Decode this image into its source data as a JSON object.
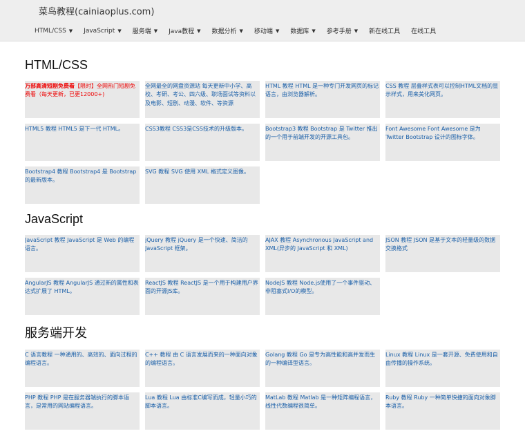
{
  "header": {
    "brand": "菜鸟教程(cainiaoplus.com)",
    "nav": [
      {
        "label": "HTML/CSS",
        "dropdown": true
      },
      {
        "label": "JavaScript",
        "dropdown": true
      },
      {
        "label": "服务端",
        "dropdown": true
      },
      {
        "label": "Java教程",
        "dropdown": true
      },
      {
        "label": "数据分析",
        "dropdown": true
      },
      {
        "label": "移动端",
        "dropdown": true
      },
      {
        "label": "数据库",
        "dropdown": true
      },
      {
        "label": "参考手册",
        "dropdown": true
      },
      {
        "label": "新在线工具",
        "dropdown": false
      },
      {
        "label": "在线工具",
        "dropdown": false
      }
    ]
  },
  "sections": [
    {
      "title": "HTML/CSS",
      "cards": [
        {
          "ad": true,
          "ad_bold": "万部高清短剧免费看",
          "ad_rest": "【限时】全网热门短剧免费看（每天更新，已更12000+)"
        },
        {
          "text": "全网最全的网盘资源站 每天更新中小学、高校、考研、考公、四六级、职场面试等资料以及电影、短剧、动漫、软件、等资源"
        },
        {
          "text": "HTML 教程 HTML 是一种专门开发网页的标记语言，由浏览器解析。"
        },
        {
          "text": "CSS 教程 层叠样式表可以控制HTML文档的显示样式，用来美化网页。"
        },
        {
          "text": "HTML5 教程 HTML5 是下一代 HTML。"
        },
        {
          "text": "CSS3教程 CSS3是CSS技术的升级版本。"
        },
        {
          "text": "Bootstrap3 教程 Bootstrap 是 Twitter 推出的一个用于前端开发的开源工具包。"
        },
        {
          "text": "Font Awesome Font Awesome 是为 Twitter Bootstrap 设计的图标字体。"
        },
        {
          "text": "Bootstrap4 教程 Bootstrap4 是 Bootstrap 的最新版本。"
        },
        {
          "text": "SVG 教程 SVG 使用 XML 格式定义图像。"
        }
      ]
    },
    {
      "title": "JavaScript",
      "cards": [
        {
          "text": "JavaScript 教程 JavaScript 是 Web 的编程语言。"
        },
        {
          "text": "jQuery 教程 jQuery 是一个快速、简洁的JavaScript 框架。"
        },
        {
          "text": "AJAX 教程 Asynchronous JavaScript and XML(异步的 JavaScript 和 XML)"
        },
        {
          "text": "JSON 教程 JSON 是基于文本的轻量级的数据交换格式"
        },
        {
          "text": "AngularJS 教程 AngularJS 通过新的属性和表达式扩展了 HTML。"
        },
        {
          "text": "ReactJS 教程 ReactJS 是一个用于构建用户界面的开源JS库。"
        },
        {
          "text": "NodeJS 教程 Node.js使用了一个事件驱动、非阻塞式I/O的模型。"
        }
      ]
    },
    {
      "title": "服务端开发",
      "cards": [
        {
          "text": "C 语言教程 一种通用的、高效的、面向过程的编程语言。"
        },
        {
          "text": "C++ 教程 由 C 语言发展而来的一种面向对象的编程语言。"
        },
        {
          "text": "Golang 教程 Go 是专为高性能和高并发而生的一种编译型语言。"
        },
        {
          "text": "Linux 教程 Linux 是一套开源、免费使用和自由传播的操作系统。"
        },
        {
          "text": "PHP 教程 PHP 是在服务器端执行的脚本语言，是常用的网站编程语言。"
        },
        {
          "text": "Lua 教程 Lua 由标准C编写而成，轻量小巧的脚本语言。"
        },
        {
          "text": "MatLab 教程 Matlab 是一种矩阵编程语言，线性代数编程很简单。"
        },
        {
          "text": "Ruby 教程 Ruby 一种简单快捷的面向对象脚本语言。"
        }
      ]
    }
  ]
}
